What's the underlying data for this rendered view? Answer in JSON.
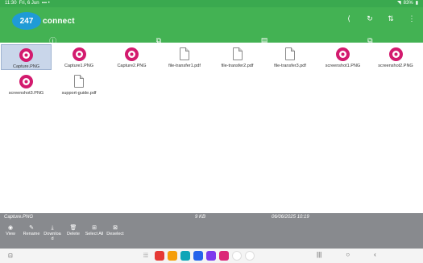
{
  "status_bar": {
    "time": "11:30",
    "date": "Fri, 6 Jun",
    "battery": "83%"
  },
  "app": {
    "logo_number": "247",
    "logo_text": "connect"
  },
  "header_icons": [
    "share-icon",
    "refresh-icon",
    "sort-icon",
    "more-icon"
  ],
  "tabs": [
    {
      "name": "info",
      "icon": "ⓘ"
    },
    {
      "name": "files",
      "icon": "⧉",
      "active": true
    },
    {
      "name": "messages",
      "icon": "▤"
    },
    {
      "name": "transfer",
      "icon": "⧉"
    }
  ],
  "files": [
    {
      "name": "Capture.PNG",
      "type": "png",
      "selected": true
    },
    {
      "name": "Capture1.PNG",
      "type": "png"
    },
    {
      "name": "Capture2.PNG",
      "type": "png"
    },
    {
      "name": "file-transfer1.pdf",
      "type": "pdf"
    },
    {
      "name": "file-transfer2.pdf",
      "type": "pdf"
    },
    {
      "name": "file-transfer3.pdf",
      "type": "pdf"
    },
    {
      "name": "screenshot1.PNG",
      "type": "png"
    },
    {
      "name": "screenshot2.PNG",
      "type": "png"
    },
    {
      "name": "screenshot3.PNG",
      "type": "png"
    },
    {
      "name": "support-guide.pdf",
      "type": "pdf"
    }
  ],
  "details": {
    "file_name": "Capture.PNG",
    "size": "9 KB",
    "date": "06/06/2025 10:19"
  },
  "actions": [
    {
      "label": "View",
      "icon": "◉"
    },
    {
      "label": "Rename",
      "icon": "✎"
    },
    {
      "label": "Downloa\nd",
      "icon": "⤓"
    },
    {
      "label": "Delete",
      "icon": "🗑"
    },
    {
      "label": "Select All",
      "icon": "⊞"
    },
    {
      "label": "Deselect",
      "icon": "⊠"
    }
  ],
  "dock_colors": [
    "#e53935",
    "#f59e0b",
    "#0ea5b7",
    "#2563eb",
    "#7c3aed",
    "#db2777",
    "#ffffff",
    "#ffffff"
  ]
}
